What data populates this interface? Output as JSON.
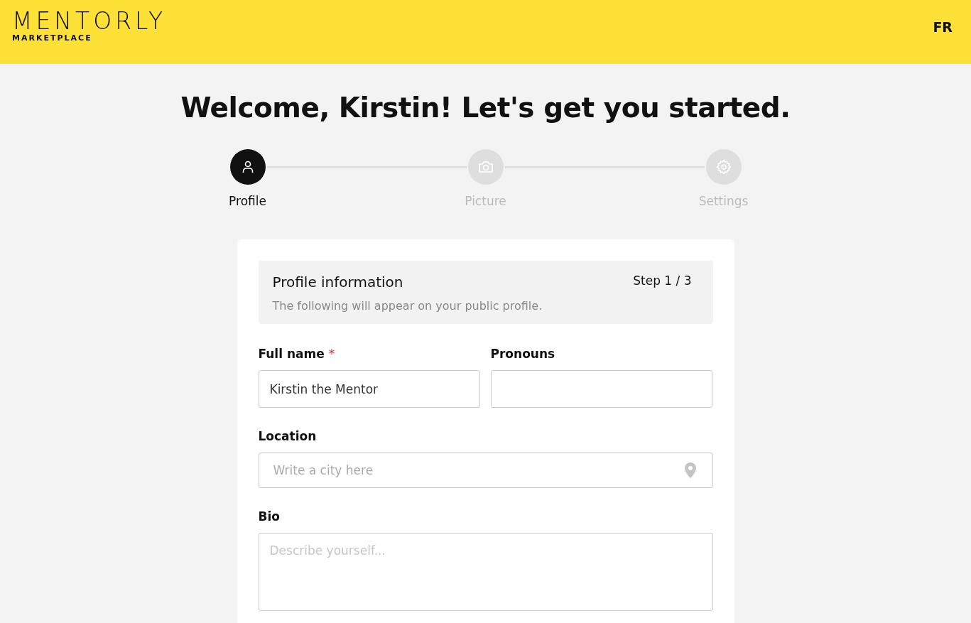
{
  "header": {
    "logo": {
      "name": "MENTORLY",
      "tagline": "MARKETPLACE"
    },
    "language": "FR"
  },
  "title": "Welcome, Kirstin! Let's get you started.",
  "steps": [
    {
      "label": "Profile",
      "selected": true
    },
    {
      "label": "Picture",
      "selected": false
    },
    {
      "label": "Settings",
      "selected": false
    }
  ],
  "card": {
    "heading": "Profile information",
    "step": "Step 1 / 3",
    "description": "The following will appear on your public profile.",
    "fields": [
      {
        "kind": "text",
        "label": "Full name",
        "required_mark": "*",
        "value": "Kirstin the Mentor"
      },
      {
        "kind": "text",
        "label": "Pronouns"
      },
      {
        "kind": "location",
        "label": "Location",
        "placeholder": "Write a city here"
      },
      {
        "kind": "textarea",
        "label": "Bio",
        "placeholder": "Describe yourself..."
      }
    ]
  }
}
